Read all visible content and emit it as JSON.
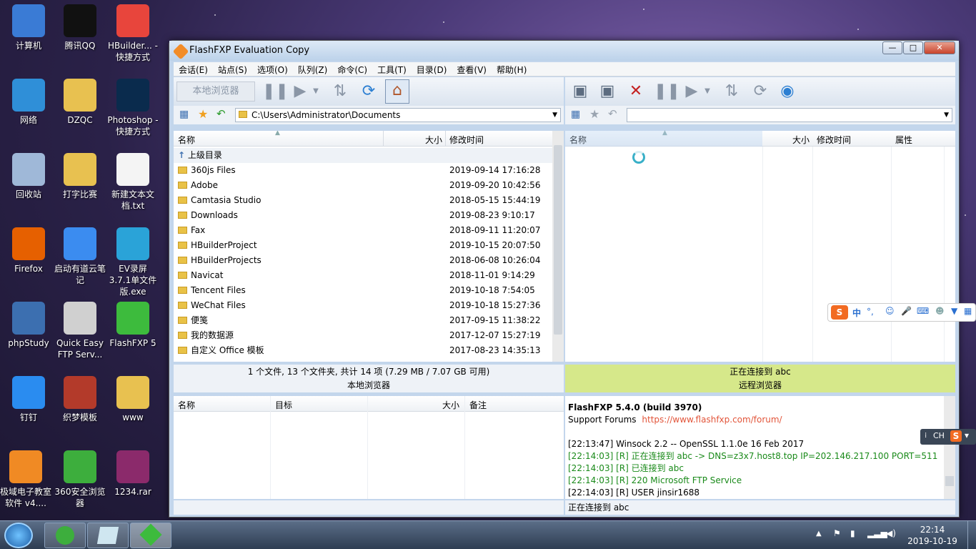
{
  "desktop": {
    "icons": [
      {
        "label": "计算机",
        "color": "#3a7bd5"
      },
      {
        "label": "腾讯QQ",
        "color": "#111111"
      },
      {
        "label": "HBuilder... - 快捷方式",
        "color": "#e8453c"
      },
      {
        "label": "网络",
        "color": "#2f8fd8"
      },
      {
        "label": "DZQC",
        "color": "#e8c150"
      },
      {
        "label": "Photoshop - 快捷方式",
        "color": "#0a2b4d"
      },
      {
        "label": "回收站",
        "color": "#9fb8d8"
      },
      {
        "label": "打字比赛",
        "color": "#e8c150"
      },
      {
        "label": "新建文本文档.txt",
        "color": "#f4f4f4"
      },
      {
        "label": "Firefox",
        "color": "#e66000"
      },
      {
        "label": "启动有道云笔记",
        "color": "#3b8cf0"
      },
      {
        "label": "EV录屏 3.7.1单文件版.exe",
        "color": "#2aa3d8"
      },
      {
        "label": "phpStudy",
        "color": "#3c6fb0"
      },
      {
        "label": "Quick Easy FTP Serv...",
        "color": "#d0d0d0"
      },
      {
        "label": "FlashFXP 5",
        "color": "#3dbb3d"
      },
      {
        "label": "钉钉",
        "color": "#2a8cf0"
      },
      {
        "label": "织梦模板",
        "color": "#b33a2a"
      },
      {
        "label": "www",
        "color": "#e8c150"
      },
      {
        "label": "极域电子教室软件 v4....",
        "color": "#f08a24"
      },
      {
        "label": "360安全浏览器",
        "color": "#3dae3d"
      },
      {
        "label": "1234.rar",
        "color": "#8b2a6b"
      }
    ]
  },
  "window": {
    "title": "FlashFXP Evaluation Copy",
    "min": "—",
    "max": "□",
    "close": "✕"
  },
  "menu": [
    "会话(E)",
    "站点(S)",
    "选项(O)",
    "队列(Z)",
    "命令(C)",
    "工具(T)",
    "目录(D)",
    "查看(V)",
    "帮助(H)"
  ],
  "left": {
    "toolbar_label": "本地浏览器",
    "path": "C:\\Users\\Administrator\\Documents",
    "headers": {
      "name": "名称",
      "size": "大小",
      "modified": "修改时间"
    },
    "parent": "上级目录",
    "files": [
      {
        "name": "360js Files",
        "date": "2019-09-14 17:16:28"
      },
      {
        "name": "Adobe",
        "date": "2019-09-20 10:42:56"
      },
      {
        "name": "Camtasia Studio",
        "date": "2018-05-15 15:44:19"
      },
      {
        "name": "Downloads",
        "date": "2019-08-23 9:10:17"
      },
      {
        "name": "Fax",
        "date": "2018-09-11 11:20:07"
      },
      {
        "name": "HBuilderProject",
        "date": "2019-10-15 20:07:50"
      },
      {
        "name": "HBuilderProjects",
        "date": "2018-06-08 10:26:04"
      },
      {
        "name": "Navicat",
        "date": "2018-11-01 9:14:29"
      },
      {
        "name": "Tencent Files",
        "date": "2019-10-18 7:54:05"
      },
      {
        "name": "WeChat Files",
        "date": "2019-10-18 15:27:36"
      },
      {
        "name": "便笺",
        "date": "2017-09-15 11:38:22"
      },
      {
        "name": "我的数据源",
        "date": "2017-12-07 15:27:19"
      },
      {
        "name": "自定义 Office 模板",
        "date": "2017-08-23 14:35:13"
      }
    ],
    "status": "1 个文件, 13 个文件夹, 共计 14 项 (7.29 MB / 7.07 GB 可用)",
    "pane_label": "本地浏览器"
  },
  "right": {
    "path": "",
    "headers": {
      "name": "名称",
      "size": "大小",
      "modified": "修改时间",
      "attr": "属性"
    },
    "status": "正在连接到 abc",
    "pane_label": "远程浏览器"
  },
  "queue": {
    "headers": {
      "name": "名称",
      "target": "目标",
      "size": "大小",
      "note": "备注"
    }
  },
  "log": {
    "title": "FlashFXP 5.4.0 (build 3970)",
    "forum_label": "Support Forums",
    "forum_link": "https://www.flashfxp.com/forum/",
    "lines": [
      {
        "text": "[22:13:47]  Winsock 2.2 -- OpenSSL 1.1.0e  16 Feb 2017",
        "color": "#000000"
      },
      {
        "text": "[22:14:03]  [R] 正在连接到 abc -> DNS=z3x7.host8.top IP=202.146.217.100 PORT=511",
        "color": "#1a8a1a"
      },
      {
        "text": "[22:14:03]  [R] 已连接到 abc",
        "color": "#1a8a1a"
      },
      {
        "text": "[22:14:03]  [R] 220 Microsoft FTP Service",
        "color": "#1a8a1a"
      },
      {
        "text": "[22:14:03]  [R] USER jinsir1688",
        "color": "#000000"
      }
    ]
  },
  "bottom_status": "正在连接到 abc",
  "ime": {
    "lang": "中",
    "punct": "°,",
    "lang2": "CH"
  },
  "tray": {
    "time": "22:14",
    "date": "2019-10-19"
  }
}
